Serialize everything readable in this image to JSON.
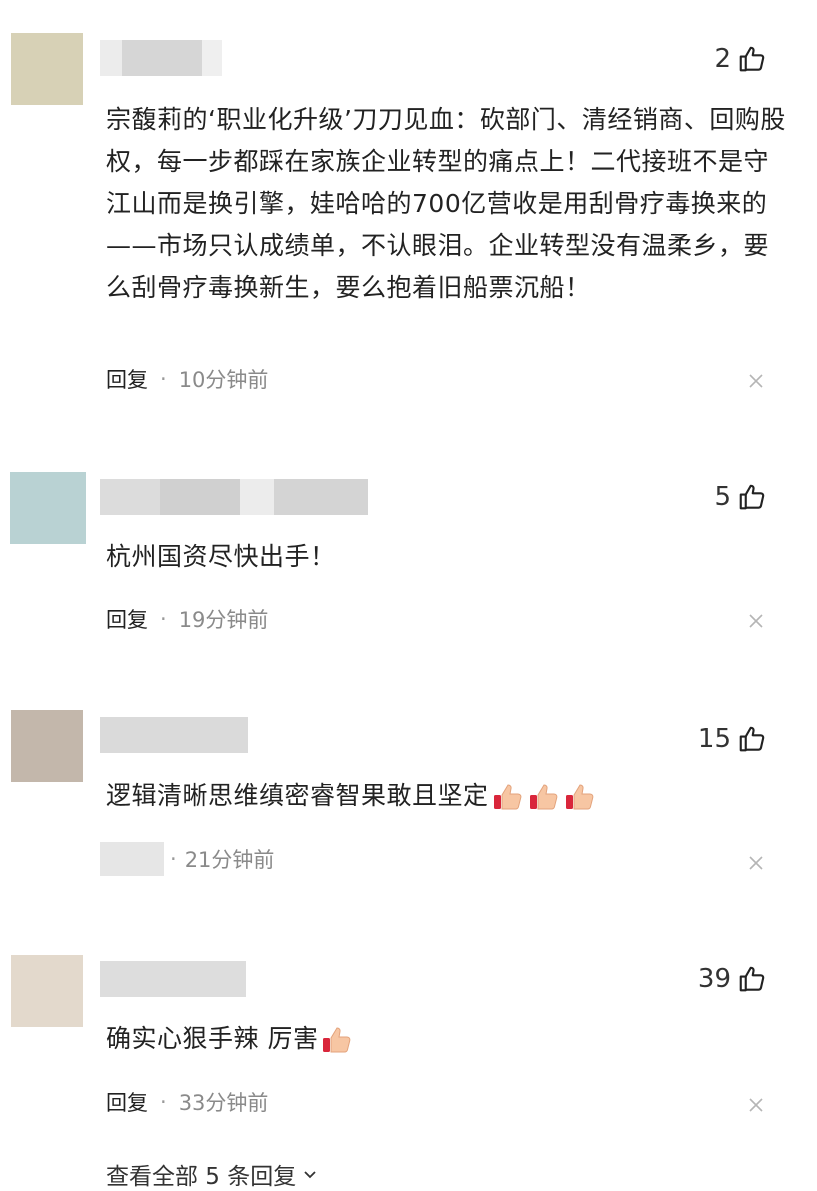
{
  "comments": [
    {
      "likes": "2",
      "text": "宗馥莉的‘职业化升级’刀刀见血：砍部门、清经销商、回购股权，每一步都踩在家族企业转型的痛点上！二代接班不是守江山而是换引擎，娃哈哈的700亿营收是用刮骨疗毒换来的——市场只认成绩单，不认眼泪。企业转型没有温柔乡，要么刮骨疗毒换新生，要么抱着旧船票沉船！",
      "reply": "回复",
      "time": "10分钟前",
      "avatar_color": "#d7d1b6"
    },
    {
      "likes": "5",
      "text": "杭州国资尽快出手！",
      "reply": "回复",
      "time": "19分钟前",
      "avatar_color": "#b9d2d3"
    },
    {
      "likes": "15",
      "text": "逻辑清晰思维缜密睿智果敢且坚定",
      "reply": "",
      "time": "21分钟前",
      "avatar_color": "#c3b7ab"
    },
    {
      "likes": "39",
      "text": "确实心狠手辣 厉害",
      "reply": "回复",
      "time": "33分钟前",
      "avatar_color": "#e3d9cc"
    }
  ],
  "separator": "·",
  "view_all": "查看全部 5 条回复",
  "icons": {
    "like": "thumbs-up-outline-icon",
    "close": "close-icon",
    "emoji": "thumbs-up-emoji-icon",
    "more": "chevron-down-icon"
  }
}
